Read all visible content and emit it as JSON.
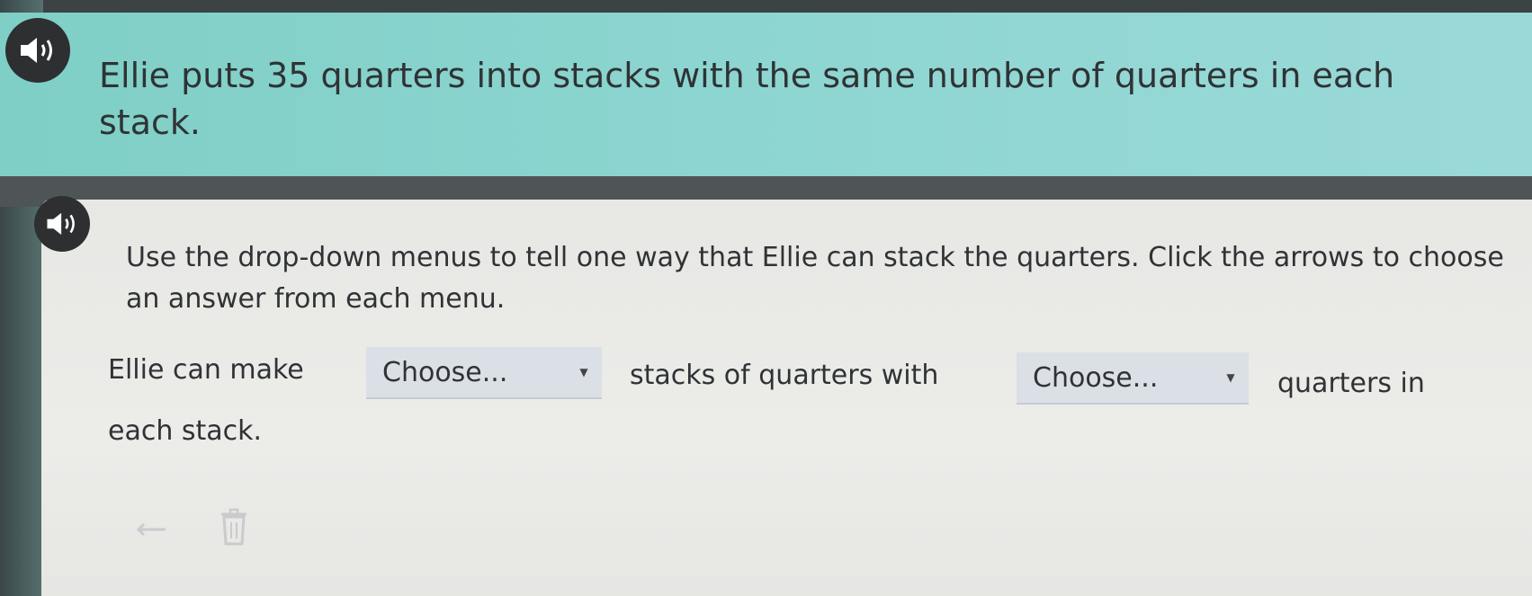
{
  "prompt": {
    "text": "Ellie puts 35 quarters into stacks with the same number of quarters in each stack.",
    "speaker_icon": "speaker-icon"
  },
  "task": {
    "instruction": "Use the drop-down menus to tell one way that Ellie can stack the quarters. Click the arrows to choose an answer from each menu.",
    "speaker_icon": "speaker-icon",
    "sentence": {
      "part1": "Ellie can make",
      "dropdown1": "Choose...",
      "part2": "stacks of quarters with",
      "dropdown2": "Choose...",
      "part3": "quarters in",
      "part4": "each stack."
    }
  },
  "tools": {
    "undo_icon": "undo-icon",
    "trash_icon": "trash-icon"
  },
  "colors": {
    "prompt_bg": "#8fd6d2",
    "panel_bg": "#e9e9e6",
    "dropdown_bg": "#dbe0e6",
    "text": "#2f3335"
  }
}
